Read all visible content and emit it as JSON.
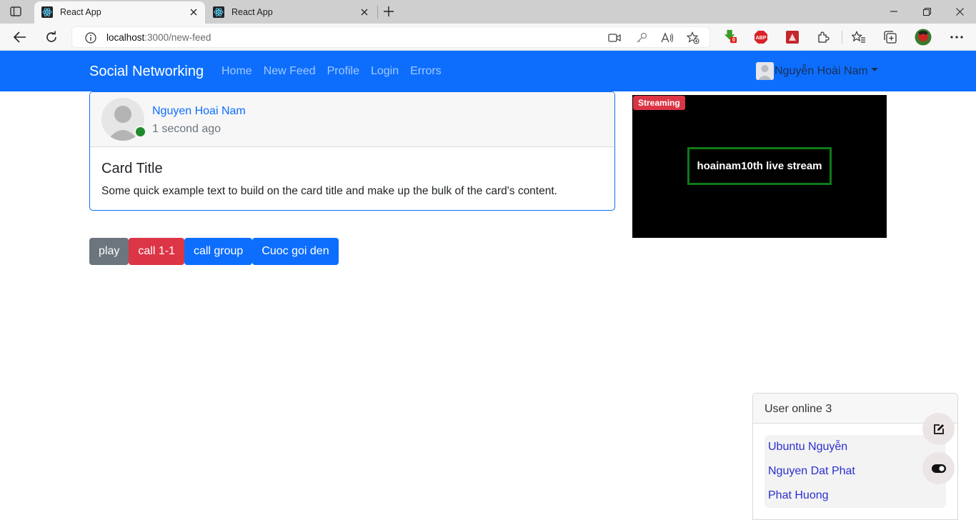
{
  "browser": {
    "tabs": [
      {
        "title": "React App",
        "active": true
      },
      {
        "title": "React App",
        "active": false
      }
    ],
    "address": {
      "host": "localhost",
      "rest": ":3000/new-feed"
    },
    "extension_badge": "0"
  },
  "navbar": {
    "brand": "Social Networking",
    "links": [
      "Home",
      "New Feed",
      "Profile",
      "Login",
      "Errors"
    ],
    "user_name": "Nguyễn Hoài Nam",
    "color": "#0d6efd"
  },
  "post": {
    "author": "Nguyen Hoai Nam",
    "time": "1 second ago",
    "title": "Card Title",
    "text": "Some quick example text to build on the card title and make up the bulk of the card's content.",
    "online_color": "#1e8c2a"
  },
  "actions": {
    "play": "play",
    "call_one": "call 1-1",
    "call_group": "call group",
    "incoming": "Cuoc goi den"
  },
  "stream": {
    "badge": "Streaming",
    "label": "hoainam10th live stream"
  },
  "online": {
    "title": "User online 3",
    "users": [
      "Ubuntu Nguyễn",
      "Nguyen Dat Phat",
      "Phat Huong"
    ]
  },
  "icons": {
    "tab_favicon": "react-icon",
    "fab_top": "edit-icon",
    "fab_bottom": "toggle-icon"
  }
}
